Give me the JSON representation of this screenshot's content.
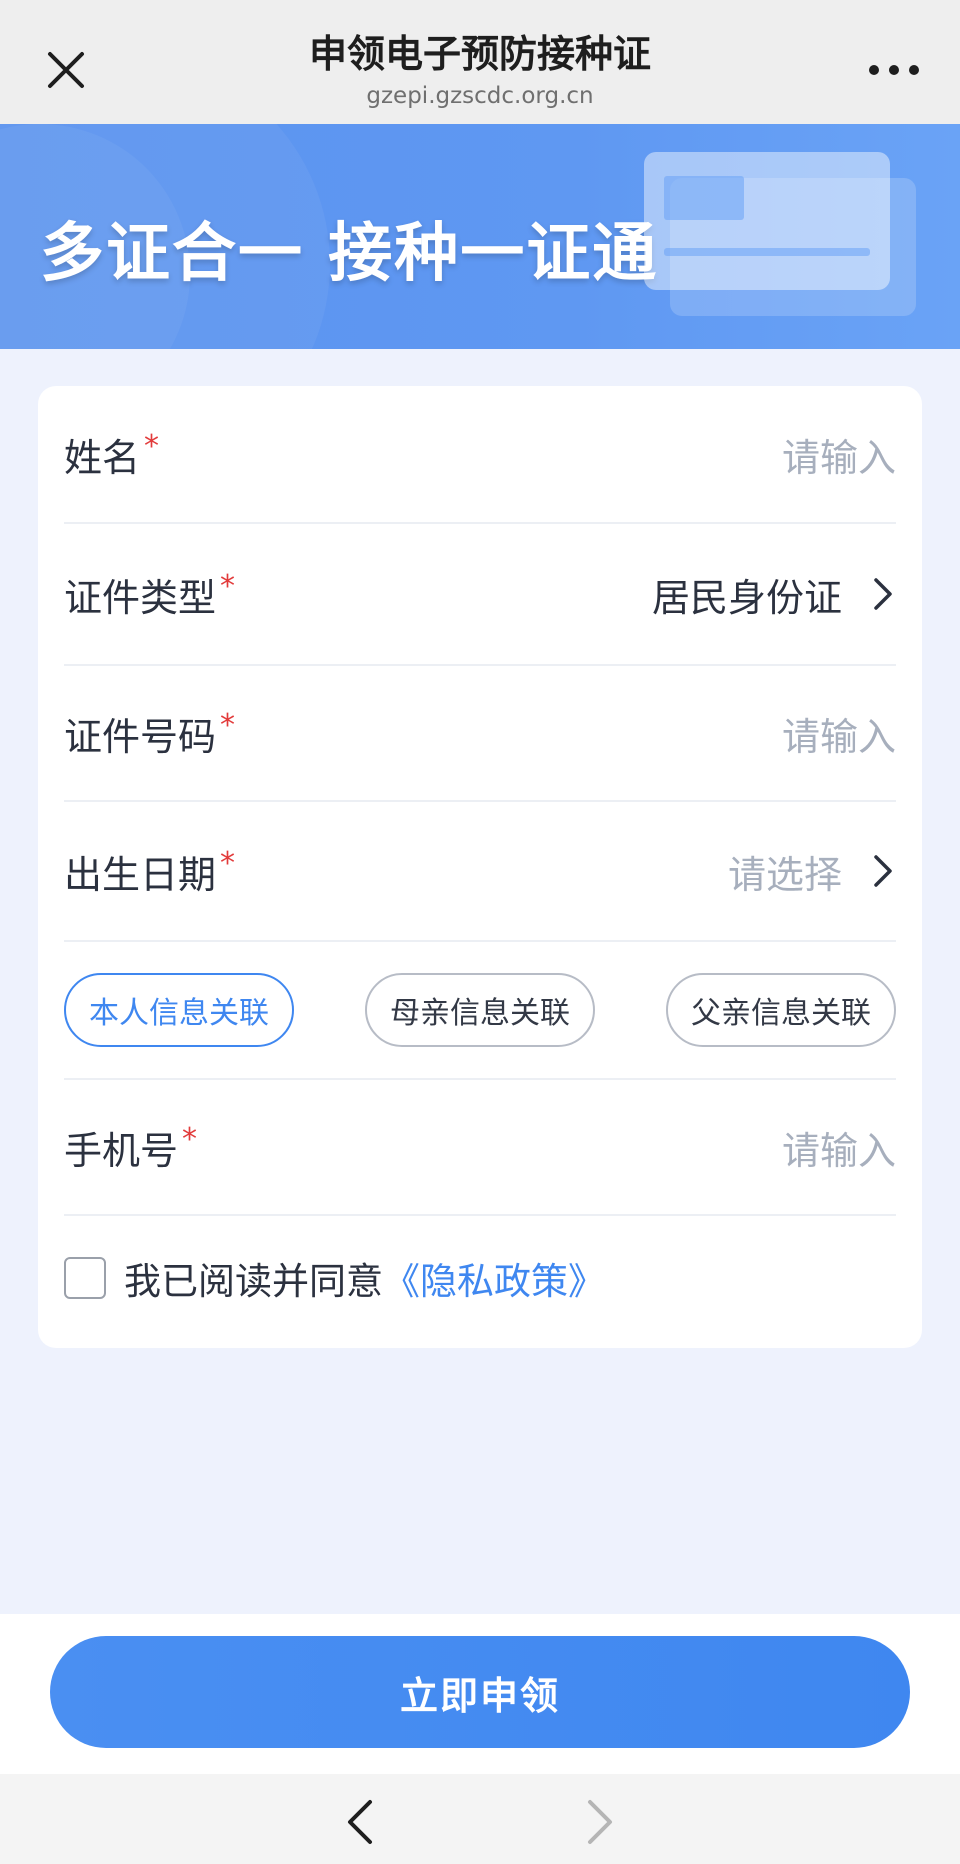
{
  "header": {
    "title": "申领电子预防接种证",
    "url": "gzepi.gzscdc.org.cn"
  },
  "banner": {
    "slogan": "多证合一 接种一证通"
  },
  "form": {
    "name": {
      "label": "姓名",
      "required_mark": "*",
      "placeholder": "请输入"
    },
    "id_type": {
      "label": "证件类型",
      "required_mark": "*",
      "value": "居民身份证"
    },
    "id_number": {
      "label": "证件号码",
      "required_mark": "*",
      "placeholder": "请输入"
    },
    "birth_date": {
      "label": "出生日期",
      "required_mark": "*",
      "placeholder": "请选择"
    },
    "relations": [
      {
        "label": "本人信息关联",
        "active": true
      },
      {
        "label": "母亲信息关联",
        "active": false
      },
      {
        "label": "父亲信息关联",
        "active": false
      }
    ],
    "phone": {
      "label": "手机号",
      "required_mark": "*",
      "placeholder": "请输入"
    },
    "agreement": {
      "text": "我已阅读并同意",
      "link": "《隐私政策》",
      "checked": false
    }
  },
  "actions": {
    "submit_label": "立即申领"
  },
  "colors": {
    "primary": "#3f87f0",
    "required": "#e23b3b",
    "page_bg": "#eef2fd"
  },
  "icons": {
    "close": "close-icon",
    "more": "more-icon",
    "chevron": "chevron-right-icon",
    "back": "back-icon",
    "forward": "forward-icon"
  }
}
